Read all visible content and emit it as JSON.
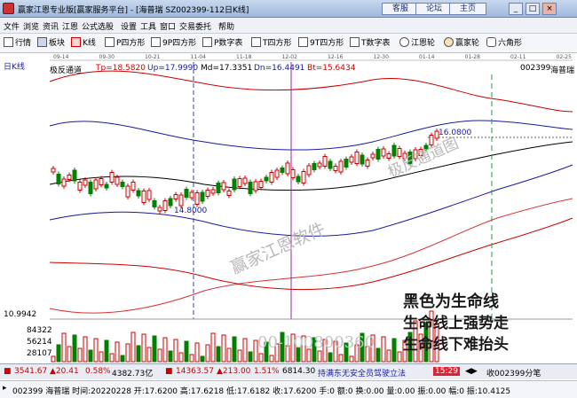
{
  "titlebar": {
    "title": "赢家江恩专业版[赢家服务平台] - [海普瑞  SZ002399-112日K线]",
    "links": [
      "客服",
      "论坛",
      "主页"
    ],
    "window_buttons": [
      "_",
      "□",
      "×"
    ]
  },
  "menu": [
    "文件",
    "浏览",
    "资讯",
    "江恩",
    "公式选股",
    "设置",
    "工具",
    "窗口",
    "交易委托",
    "帮助"
  ],
  "toolbar": [
    {
      "label": "行情",
      "icon": "grid-icon"
    },
    {
      "label": "板块",
      "icon": "blocks-icon"
    },
    {
      "label": "K线",
      "icon": "candlestick-icon"
    },
    {
      "label": "P四方形",
      "icon": "square-p-icon"
    },
    {
      "label": "9P四方形",
      "icon": "square-9p-icon"
    },
    {
      "label": "P数字表",
      "icon": "table-p-icon"
    },
    {
      "label": "T四方形",
      "icon": "square-t-icon"
    },
    {
      "label": "9T四方形",
      "icon": "square-9t-icon"
    },
    {
      "label": "T数字表",
      "icon": "table-t-icon"
    },
    {
      "label": "江恩轮",
      "icon": "wheel-icon"
    },
    {
      "label": "赢家轮",
      "icon": "winner-wheel-icon"
    },
    {
      "label": "六角形",
      "icon": "hexagon-icon"
    }
  ],
  "chart": {
    "period_label": "日K线",
    "indicator_name": "极反通道",
    "legend": [
      {
        "label": "Tp=18.5820",
        "color": "#d00000"
      },
      {
        "label": "Up=17.9990",
        "color": "#1a1aa6"
      },
      {
        "label": "Md=17.3351",
        "color": "#000000"
      },
      {
        "label": "Dn=16.4491",
        "color": "#1a1aa6"
      },
      {
        "label": "Bt=15.6434",
        "color": "#d00000"
      }
    ],
    "stock_code": "002399",
    "stock_name": "海普瑞",
    "date_ticks": [
      "09-14",
      "09-30",
      "10-21",
      "11-04",
      "11-18",
      "12-02",
      "12-16",
      "12-30",
      "01-14",
      "01-28",
      "02-11",
      "02-25"
    ],
    "label_low": "14.8000",
    "label_high": "16.0800",
    "axis_left_value": "10.9942",
    "volume_ticks": [
      "84322",
      "56214",
      "28107"
    ],
    "watermarks": [
      "极反通道图",
      "赢家江恩软件",
      "00-100800360"
    ],
    "annotations": [
      "黑色为生命线",
      "生命线上强势走",
      "生命线下难抬头"
    ],
    "colors": {
      "up": "#d00000",
      "down": "#008000",
      "channel_outer": "#d00000",
      "channel_inner": "#1a1aa6",
      "life_line": "#000000",
      "cursor": "#9a2aa6"
    }
  },
  "status": {
    "sh_index": "3541.67",
    "sh_change": "▲20.41",
    "sh_pct": "0.58%",
    "sh_amount": "4382.73亿",
    "sz_index": "14363.57",
    "sz_change": "▲213.00",
    "sz_pct": "1.51%",
    "sz_amount": "6814.30",
    "ticker_news": "持满东无安全员驾驶立法",
    "time": "15:29",
    "watch_label": "收002399分笔"
  },
  "detail": {
    "text": "002399 海普瑞 时间:20220228 开:17.6200 高:17.6218 低:17.6182 收:17.6200 手:0 额:0 换:0.00 量:0.00 振:0.00 幅:0 振:10.4125"
  }
}
